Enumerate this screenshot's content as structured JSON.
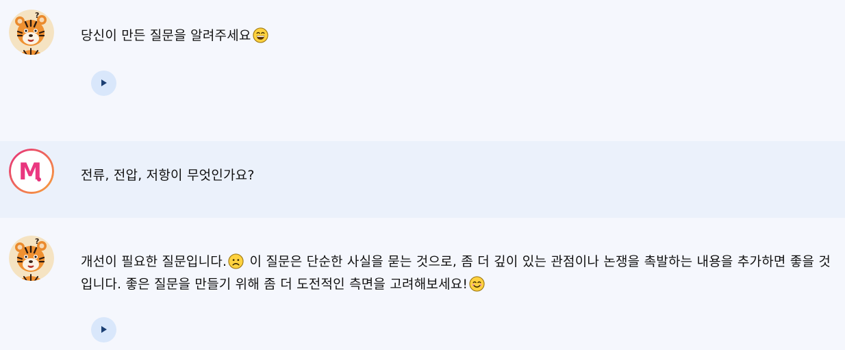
{
  "messages": [
    {
      "sender": "tiger-bot",
      "text": "당신이 만든 질문을 알려주세요",
      "emoji": "grinning-smiling-eyes",
      "has_audio": true
    },
    {
      "sender": "user",
      "avatar_letter": "M",
      "text": "전류, 전압, 저항이 무엇인가요?"
    },
    {
      "sender": "tiger-bot",
      "text_part1": "개선이 필요한 질문입니다.",
      "emoji1": "sad-face",
      "text_part2": " 이 질문은 단순한 사실을 묻는 것으로, 좀 더 깊이 있는 관점이나 논쟁을 촉발하는 내용을 추가하면 좋을 것입니다. 좋은 질문을 만들기 위해 좀 더 도전적인 측면을 고려해보세요!",
      "emoji2": "smiling-face",
      "has_audio": true
    }
  ],
  "colors": {
    "bot_row_bg": "#f5f7fd",
    "user_row_bg": "#ebf1fb",
    "play_button_bg": "#d9e7fb",
    "play_icon": "#1b3f73",
    "user_avatar_pink": "#e6327a",
    "user_avatar_orange": "#f7a23b"
  }
}
